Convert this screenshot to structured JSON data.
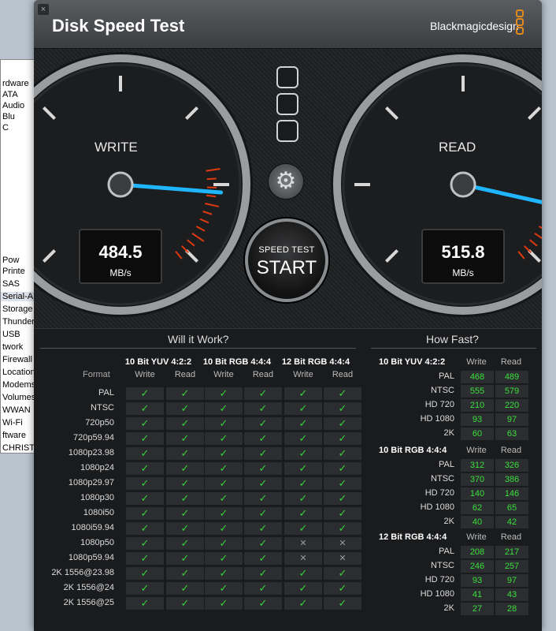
{
  "window": {
    "title": "Disk Speed Test",
    "brand": "Blackmagicdesign",
    "close_glyph": "×"
  },
  "background_sidebar": [
    "rdware",
    "ATA",
    "Audio",
    "Blu",
    "C",
    "Pow",
    "Printe",
    "SAS",
    "Serial-A",
    "Storage",
    "Thunder",
    "USB",
    "twork",
    "Firewall",
    "Location",
    "Modems",
    "Volumes",
    "WWAN",
    "Wi-Fi",
    "ftware",
    "CHRISTO"
  ],
  "gauges": {
    "write": {
      "label": "WRITE",
      "value": "484.5",
      "unit": "MB/s",
      "fraction": 0.85
    },
    "read": {
      "label": "READ",
      "value": "515.8",
      "unit": "MB/s",
      "fraction": 0.88
    }
  },
  "start_button": {
    "small": "SPEED TEST",
    "big": "START"
  },
  "gear_glyph": "⚙",
  "will_it_work": {
    "header": "Will it Work?",
    "groups": [
      "10 Bit YUV 4:2:2",
      "10 Bit RGB 4:4:4",
      "12 Bit RGB 4:4:4"
    ],
    "format_label": "Format",
    "write_label": "Write",
    "read_label": "Read",
    "check": "✓",
    "cross": "✕",
    "rows": [
      {
        "name": "PAL",
        "v": [
          1,
          1,
          1,
          1,
          1,
          1
        ]
      },
      {
        "name": "NTSC",
        "v": [
          1,
          1,
          1,
          1,
          1,
          1
        ]
      },
      {
        "name": "720p50",
        "v": [
          1,
          1,
          1,
          1,
          1,
          1
        ]
      },
      {
        "name": "720p59.94",
        "v": [
          1,
          1,
          1,
          1,
          1,
          1
        ]
      },
      {
        "name": "1080p23.98",
        "v": [
          1,
          1,
          1,
          1,
          1,
          1
        ]
      },
      {
        "name": "1080p24",
        "v": [
          1,
          1,
          1,
          1,
          1,
          1
        ]
      },
      {
        "name": "1080p29.97",
        "v": [
          1,
          1,
          1,
          1,
          1,
          1
        ]
      },
      {
        "name": "1080p30",
        "v": [
          1,
          1,
          1,
          1,
          1,
          1
        ]
      },
      {
        "name": "1080i50",
        "v": [
          1,
          1,
          1,
          1,
          1,
          1
        ]
      },
      {
        "name": "1080i59.94",
        "v": [
          1,
          1,
          1,
          1,
          1,
          1
        ]
      },
      {
        "name": "1080p50",
        "v": [
          1,
          1,
          1,
          1,
          0,
          0
        ]
      },
      {
        "name": "1080p59.94",
        "v": [
          1,
          1,
          1,
          1,
          0,
          0
        ]
      },
      {
        "name": "2K 1556@23.98",
        "v": [
          1,
          1,
          1,
          1,
          1,
          1
        ]
      },
      {
        "name": "2K 1556@24",
        "v": [
          1,
          1,
          1,
          1,
          1,
          1
        ]
      },
      {
        "name": "2K 1556@25",
        "v": [
          1,
          1,
          1,
          1,
          1,
          1
        ]
      }
    ]
  },
  "how_fast": {
    "header": "How Fast?",
    "write_label": "Write",
    "read_label": "Read",
    "sections": [
      {
        "title": "10 Bit YUV 4:2:2",
        "rows": [
          {
            "name": "PAL",
            "w": "468",
            "r": "489"
          },
          {
            "name": "NTSC",
            "w": "555",
            "r": "579"
          },
          {
            "name": "HD 720",
            "w": "210",
            "r": "220"
          },
          {
            "name": "HD 1080",
            "w": "93",
            "r": "97"
          },
          {
            "name": "2K",
            "w": "60",
            "r": "63"
          }
        ]
      },
      {
        "title": "10 Bit RGB 4:4:4",
        "rows": [
          {
            "name": "PAL",
            "w": "312",
            "r": "326"
          },
          {
            "name": "NTSC",
            "w": "370",
            "r": "386"
          },
          {
            "name": "HD 720",
            "w": "140",
            "r": "146"
          },
          {
            "name": "HD 1080",
            "w": "62",
            "r": "65"
          },
          {
            "name": "2K",
            "w": "40",
            "r": "42"
          }
        ]
      },
      {
        "title": "12 Bit RGB 4:4:4",
        "rows": [
          {
            "name": "PAL",
            "w": "208",
            "r": "217"
          },
          {
            "name": "NTSC",
            "w": "246",
            "r": "257"
          },
          {
            "name": "HD 720",
            "w": "93",
            "r": "97"
          },
          {
            "name": "HD 1080",
            "w": "41",
            "r": "43"
          },
          {
            "name": "2K",
            "w": "27",
            "r": "28"
          }
        ]
      }
    ]
  },
  "colors": {
    "needle": "#1fb6ff",
    "redzone": "#e03a10",
    "ok": "#37d23a",
    "value": "#3ae03c"
  }
}
